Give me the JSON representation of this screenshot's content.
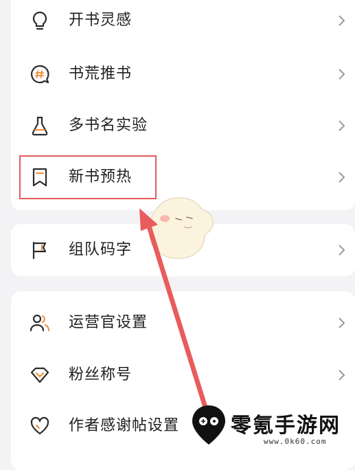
{
  "menu": {
    "group1": [
      {
        "label": "开书灵感",
        "icon": "lightbulb-icon"
      },
      {
        "label": "书荒推书",
        "icon": "hashtag-bubble-icon"
      },
      {
        "label": "多书名实验",
        "icon": "flask-icon"
      },
      {
        "label": "新书预热",
        "icon": "bookmark-icon"
      }
    ],
    "group2": [
      {
        "label": "组队码字",
        "icon": "flag-icon"
      }
    ],
    "group3": [
      {
        "label": "运营官设置",
        "icon": "users-icon"
      },
      {
        "label": "粉丝称号",
        "icon": "badge-icon"
      },
      {
        "label": "作者感谢帖设置",
        "icon": "heart-icon"
      }
    ]
  },
  "watermark": {
    "title": "零氪手游网",
    "url": "www.0k60.com"
  },
  "colors": {
    "accent": "#f08a2e",
    "highlight": "#e25b5b",
    "arrow": "#e85c5c"
  }
}
